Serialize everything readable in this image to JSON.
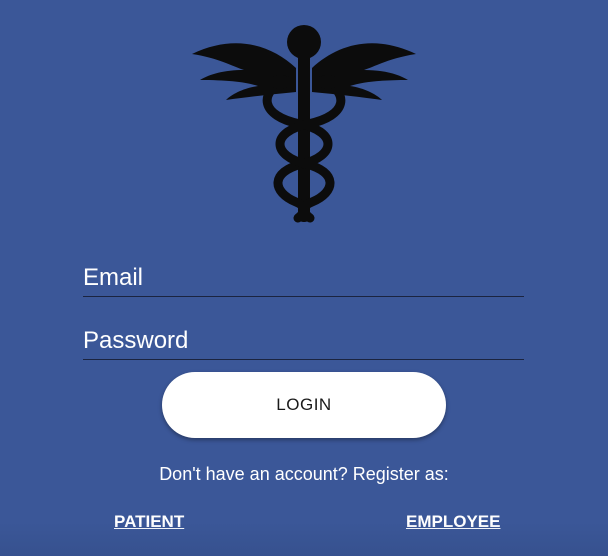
{
  "logo": {
    "icon": "caduceus-icon"
  },
  "login_form": {
    "email_placeholder": "Email",
    "password_placeholder": "Password",
    "login_label": "LOGIN"
  },
  "register": {
    "prompt": "Don't have an account? Register as:",
    "patient_label": "PATIENT",
    "employee_label": "EMPLOYEE"
  },
  "colors": {
    "background": "#3b5798",
    "button": "#ffffff",
    "text": "#ffffff"
  }
}
